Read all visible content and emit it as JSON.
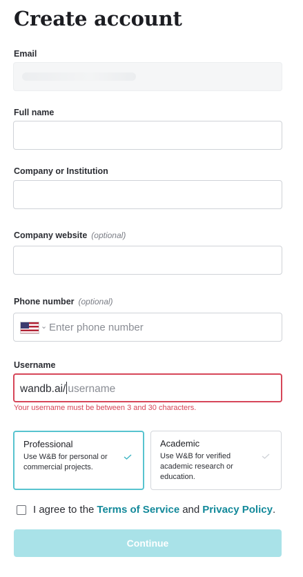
{
  "title": "Create account",
  "email": {
    "label": "Email"
  },
  "full_name": {
    "label": "Full name",
    "value": ""
  },
  "company": {
    "label": "Company or Institution",
    "value": ""
  },
  "website": {
    "label": "Company website",
    "optional": "(optional)",
    "value": ""
  },
  "phone": {
    "label": "Phone number",
    "optional": "(optional)",
    "placeholder": "Enter phone number",
    "country_icon": "us-flag-icon"
  },
  "username": {
    "label": "Username",
    "prefix": "wandb.ai/",
    "placeholder": "username",
    "error": "Your username must be between 3 and 30 characters."
  },
  "plans": [
    {
      "title": "Professional",
      "description": "Use W&B for personal or commercial projects.",
      "selected": true
    },
    {
      "title": "Academic",
      "description": "Use W&B for verified academic research or education.",
      "selected": false
    }
  ],
  "agreement": {
    "prefix": "I agree to the",
    "terms": "Terms of Service",
    "and": "and",
    "privacy": "Privacy Policy",
    "suffix": ".",
    "checked": false
  },
  "continue_label": "Continue",
  "colors": {
    "accent": "#13899a",
    "error": "#d64558",
    "selected_border": "#57c3cf",
    "button_disabled": "#a9e2e8"
  }
}
